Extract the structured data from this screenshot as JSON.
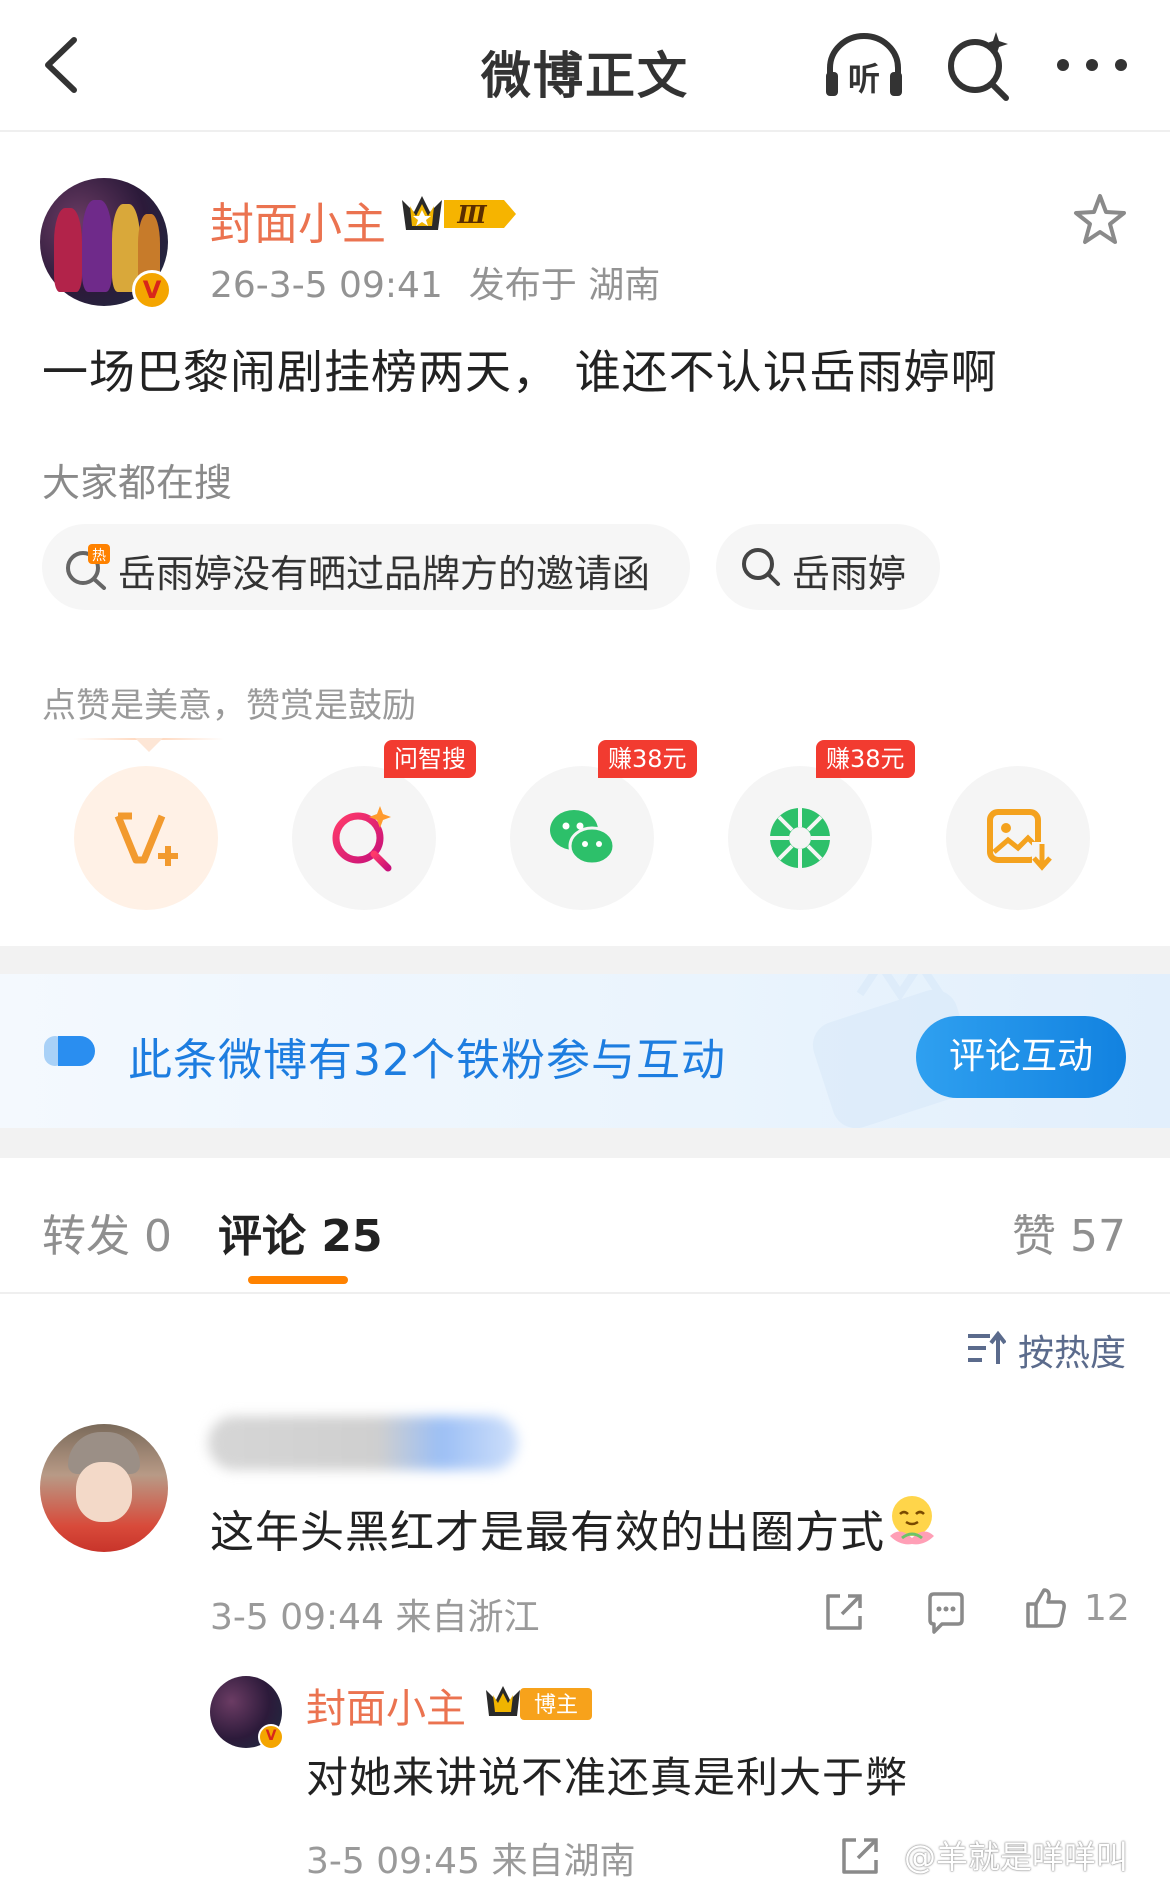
{
  "nav": {
    "title": "微博正文",
    "listen_label": "听"
  },
  "post": {
    "author": "封面小主",
    "author_level": "Ⅲ",
    "verified_mark": "V",
    "time": "26-3-5 09:41",
    "location": "发布于 湖南",
    "text": "一场巴黎闹剧挂榜两天， 谁还不认识岳雨婷啊"
  },
  "hot_search": {
    "label": "大家都在搜",
    "items": [
      {
        "icon": "hot-search-icon",
        "text": "岳雨婷没有晒过品牌方的邀请函"
      },
      {
        "icon": "search-icon",
        "text": "岳雨婷"
      }
    ]
  },
  "reward": {
    "label": "点赞是美意，赞赏是鼓励",
    "buttons": [
      {
        "icon": "v-plus-icon",
        "tag": ""
      },
      {
        "icon": "ai-search-icon",
        "tag": "问智搜"
      },
      {
        "icon": "wechat-icon",
        "tag": "赚38元"
      },
      {
        "icon": "moments-icon",
        "tag": "赚38元"
      },
      {
        "icon": "save-image-icon",
        "tag": ""
      }
    ]
  },
  "banner": {
    "text": "此条微博有32个铁粉参与互动",
    "button": "评论互动"
  },
  "tabs": {
    "repost": {
      "label": "转发",
      "count": "0"
    },
    "comment": {
      "label": "评论",
      "count": "25"
    },
    "like": {
      "label": "赞",
      "count": "57"
    }
  },
  "sort": {
    "label": "按热度"
  },
  "comments": [
    {
      "text": "这年头黑红才是最有效的出圈方式",
      "time": "3-5 09:44",
      "location": "来自浙江",
      "likes": "12",
      "reply": {
        "author": "封面小主",
        "badge": "博主",
        "text": "对她来讲说不准还真是利大于弊",
        "time": "3-5 09:45",
        "location": "来自湖南"
      }
    }
  ],
  "watermark": "@羊就是咩咩叫",
  "colors": {
    "accent_orange": "#ff8200",
    "name_orange": "#eb7350",
    "link_blue": "#1d7de0",
    "tag_red": "#f23b30",
    "wechat_green": "#2dc06a"
  }
}
